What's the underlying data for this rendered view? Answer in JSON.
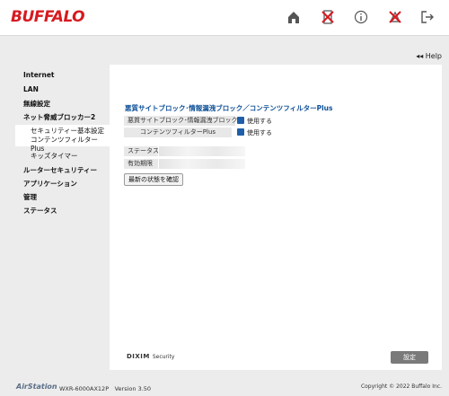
{
  "header": {
    "logo": "BUFFALO",
    "icons": [
      "home-icon",
      "network-disconnected-icon",
      "info-icon",
      "internet-disconnected-icon",
      "logout-icon"
    ]
  },
  "help": {
    "label": "◂◂ Help"
  },
  "sidebar": {
    "items": [
      {
        "label": "Internet"
      },
      {
        "label": "LAN"
      },
      {
        "label": "無線設定"
      },
      {
        "label": "ネット脅威ブロッカー2"
      },
      {
        "label": "セキュリティー基本設定"
      },
      {
        "label": "コンテンツフィルターPlus"
      },
      {
        "label": "キッズタイマー"
      },
      {
        "label": "ルーターセキュリティー"
      },
      {
        "label": "アプリケーション"
      },
      {
        "label": "管理"
      },
      {
        "label": "ステータス"
      }
    ]
  },
  "main": {
    "section_title": "悪質サイトブロック･情報漏洩ブロック／コンテンツフィルターPlus",
    "rows": [
      {
        "label": "悪質サイトブロック･情報漏洩ブロック",
        "checkbox_label": "使用する",
        "checked": true
      },
      {
        "label": "コンテンツフィルターPlus",
        "checkbox_label": "使用する",
        "checked": true
      }
    ],
    "status_label": "ステータス",
    "expiry_label": "有効期限",
    "refresh_button": "最新の状態を確認",
    "dixim": "DIXIM",
    "dixim_sub": "Security",
    "apply_button": "設定"
  },
  "footer": {
    "product": "AirStation",
    "model": "WXR-6000AX12P　Version 3.50",
    "copyright": "Copyright © 2022 Buffalo Inc."
  },
  "colors": {
    "brand": "#d71920",
    "link": "#0c4f96",
    "checkbox": "#1f5fa8"
  }
}
